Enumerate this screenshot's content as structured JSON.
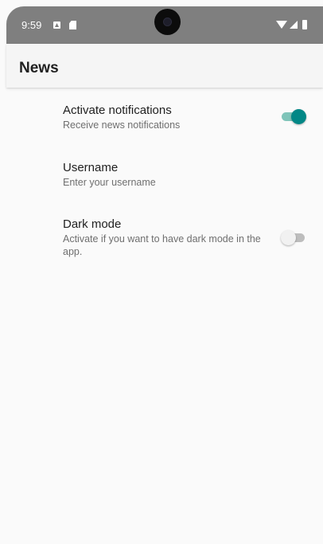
{
  "status_bar": {
    "time": "9:59",
    "icons": [
      "notification-a-icon",
      "sd-card-icon",
      "wifi-icon",
      "signal-icon",
      "battery-icon"
    ]
  },
  "app_bar": {
    "title": "News"
  },
  "preferences": [
    {
      "title": "Activate notifications",
      "summary": "Receive news notifications",
      "type": "switch",
      "checked": true
    },
    {
      "title": "Username",
      "summary": "Enter your username",
      "type": "text"
    },
    {
      "title": "Dark mode",
      "summary": "Activate if you want to have dark mode in the app.",
      "type": "switch",
      "checked": false
    }
  ],
  "colors": {
    "accent": "#018786",
    "accent_track": "#7fc4b9",
    "status_bar": "#7f7f7f",
    "app_bar": "#f5f5f5"
  }
}
